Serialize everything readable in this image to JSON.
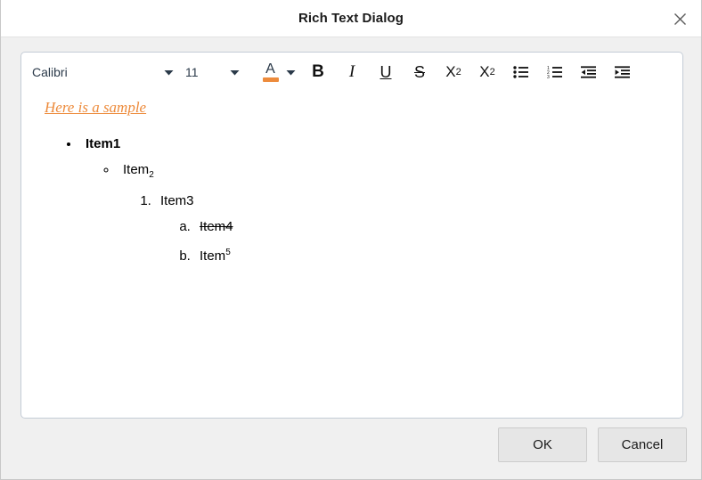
{
  "dialog": {
    "title": "Rich Text Dialog",
    "close_icon": "close-icon"
  },
  "toolbar": {
    "font_family_value": "Calibri",
    "font_size_value": "11",
    "text_color_glyph": "A",
    "text_color_hex": "#ED8B3C",
    "caret_color_hex": "#2B3A4A",
    "buttons": [
      {
        "name": "bold-button",
        "label": "B"
      },
      {
        "name": "italic-button",
        "label": "I"
      },
      {
        "name": "underline-button",
        "label": "U"
      },
      {
        "name": "strikethrough-button",
        "label": "S"
      },
      {
        "name": "subscript-button",
        "label": "X",
        "script": "2"
      },
      {
        "name": "superscript-button",
        "label": "X",
        "script": "2"
      },
      {
        "name": "bullet-list-button",
        "label": ""
      },
      {
        "name": "numbered-list-button",
        "label": ""
      },
      {
        "name": "decrease-indent-button",
        "label": ""
      },
      {
        "name": "increase-indent-button",
        "label": ""
      }
    ],
    "subscript_label": "X",
    "subscript_script": "2",
    "superscript_label": "X",
    "superscript_script": "2"
  },
  "editor": {
    "sample_text": "Here is a sample",
    "sample_color_hex": "#ED8B3C",
    "list": {
      "item1": "Item1",
      "item2_base": "Item",
      "item2_sub": "2",
      "item3": "Item3",
      "item4": "Item4",
      "item5_base": "Item",
      "item5_sup": "5"
    }
  },
  "footer": {
    "ok_label": "OK",
    "cancel_label": "Cancel"
  }
}
